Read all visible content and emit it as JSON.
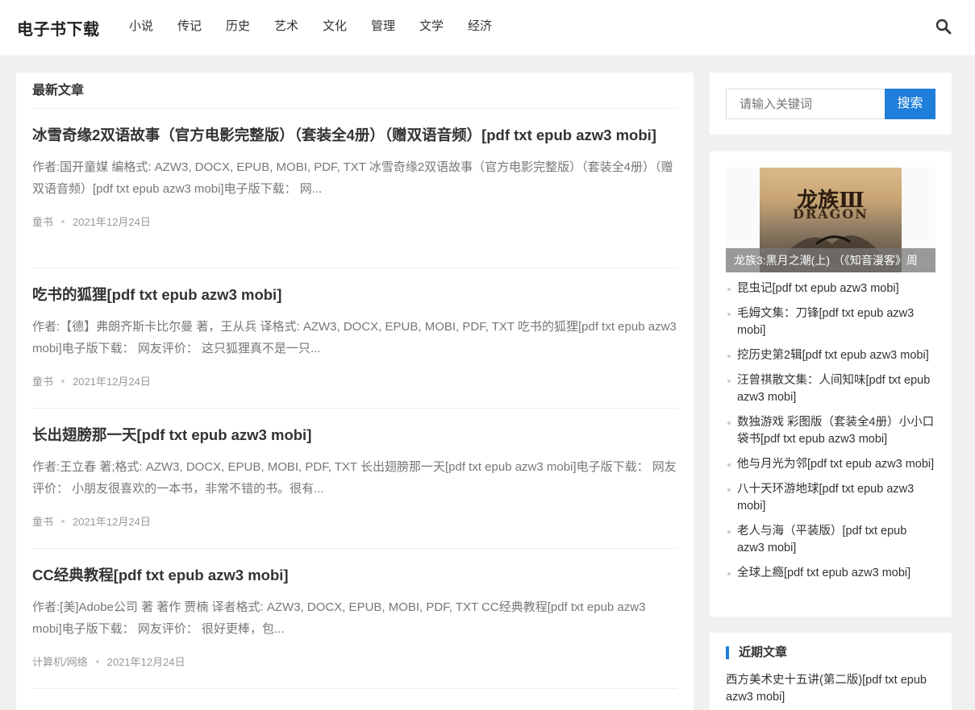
{
  "site": {
    "logo": "电子书下载"
  },
  "nav": [
    "小说",
    "传记",
    "历史",
    "艺术",
    "文化",
    "管理",
    "文学",
    "经济"
  ],
  "main": {
    "section_title": "最新文章",
    "articles": [
      {
        "title": "冰雪奇缘2双语故事（官方电影完整版）（套装全4册）（赠双语音频）[pdf txt epub azw3 mobi]",
        "excerpt": "作者:国开童媒 编格式: AZW3, DOCX, EPUB, MOBI, PDF, TXT 冰雪奇缘2双语故事（官方电影完整版）（套装全4册）（赠双语音频）[pdf txt epub azw3 mobi]电子版下载： 网...",
        "category": "童书",
        "date": "2021年12月24日"
      },
      {
        "title": "吃书的狐狸[pdf txt epub azw3 mobi]",
        "excerpt": "作者:【德】弗朗齐斯卡比尔曼 著，王从兵 译格式: AZW3, DOCX, EPUB, MOBI, PDF, TXT 吃书的狐狸[pdf txt epub azw3 mobi]电子版下载： 网友评价： 这只狐狸真不是一只...",
        "category": "童书",
        "date": "2021年12月24日"
      },
      {
        "title": "长出翅膀那一天[pdf txt epub azw3 mobi]",
        "excerpt": "作者:王立春 著;格式: AZW3, DOCX, EPUB, MOBI, PDF, TXT 长出翅膀那一天[pdf txt epub azw3 mobi]电子版下载： 网友评价： 小朋友很喜欢的一本书，非常不错的书。很有...",
        "category": "童书",
        "date": "2021年12月24日"
      },
      {
        "title": "CC经典教程[pdf txt epub azw3 mobi]",
        "excerpt": "作者:[美]Adobe公司 著 著作 贾楠 译者格式: AZW3, DOCX, EPUB, MOBI, PDF, TXT CC经典教程[pdf txt epub azw3 mobi]电子版下载： 网友评价： 很好更棒，包...",
        "category": "计算机/网络",
        "date": "2021年12月24日"
      }
    ]
  },
  "sidebar": {
    "search": {
      "placeholder": "请输入关键词",
      "button": "搜索"
    },
    "featured": {
      "caption": "龙族3:黑月之潮(上) （《知音漫客》周",
      "cover_title": "龙族Ⅲ",
      "cover_subtitle": "DRAGON"
    },
    "recommended": [
      "昆虫记[pdf txt epub azw3 mobi]",
      "毛姆文集：刀锋[pdf txt epub azw3 mobi]",
      "挖历史第2辑[pdf txt epub azw3 mobi]",
      "汪曾祺散文集：人间知味[pdf txt epub azw3 mobi]",
      "数独游戏 彩图版（套装全4册）小小口袋书[pdf txt epub azw3 mobi]",
      "他与月光为邻[pdf txt epub azw3 mobi]",
      "八十天环游地球[pdf txt epub azw3 mobi]",
      "老人与海（平装版）[pdf txt epub azw3 mobi]",
      "全球上瘾[pdf txt epub azw3 mobi]"
    ],
    "recent": {
      "title": "近期文章",
      "items": [
        "西方美术史十五讲(第二版)[pdf txt epub azw3 mobi]"
      ]
    }
  },
  "colors": {
    "accent": "#1f7ed9",
    "background": "#f0f0f0"
  },
  "icons": {
    "search": "search-icon"
  }
}
